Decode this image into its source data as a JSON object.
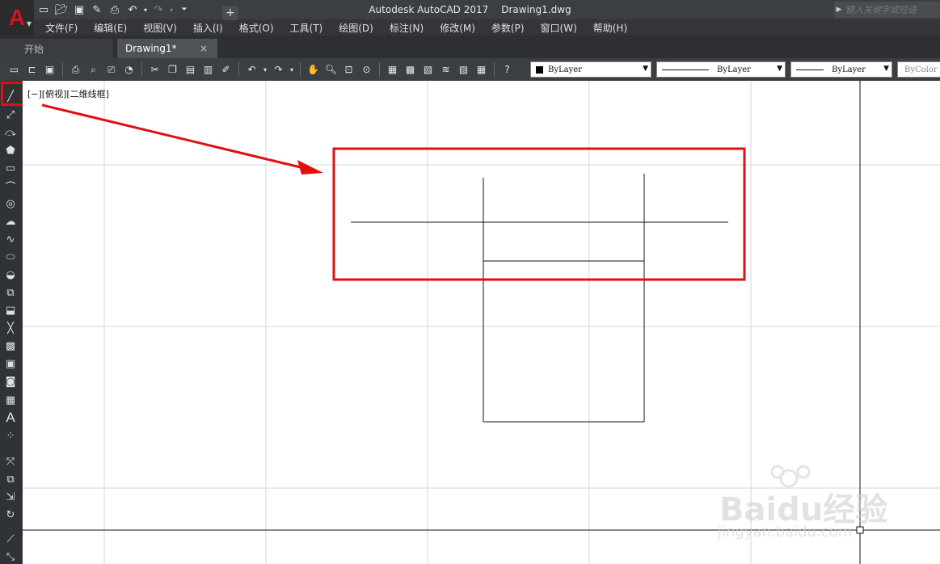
{
  "window": {
    "app_name": "Autodesk AutoCAD 2017",
    "file_name": "Drawing1.dwg",
    "search_placeholder": "键入关键字或短语"
  },
  "menus": [
    "文件(F)",
    "编辑(E)",
    "视图(V)",
    "插入(I)",
    "格式(O)",
    "工具(T)",
    "绘图(D)",
    "标注(N)",
    "修改(M)",
    "参数(P)",
    "窗口(W)",
    "帮助(H)"
  ],
  "tabs": {
    "start": "开始",
    "drawing": "Drawing1*",
    "close_glyph": "×",
    "add_glyph": "+"
  },
  "properties": {
    "color": "ByLayer",
    "linetype": "ByLayer",
    "lineweight": "ByLayer",
    "plotstyle": "ByColor"
  },
  "viewport_label": "[−][俯视][二维线框]",
  "watermark": {
    "brand": "Baidu经验",
    "url": "jingyan.baidu.com"
  },
  "colors": {
    "highlight": "#e01010",
    "accent_logo": "#d4151d"
  },
  "icons": {
    "left_palette": [
      "line-icon",
      "polyline-icon",
      "arc-icon",
      "polygon-icon",
      "rectangle-icon",
      "arc-tool-icon",
      "circle-icon",
      "revision-cloud-icon",
      "spline-icon",
      "ellipse-icon",
      "ellipse-arc-icon",
      "insert-block-icon",
      "make-block-icon",
      "point-icon",
      "hatch-icon",
      "gradient-icon",
      "region-icon",
      "table-icon",
      "multiline-text-icon",
      "add-selected-icon",
      "move-icon",
      "copy-icon",
      "stretch-icon",
      "rotate-icon",
      "mirror-icon",
      "scale-icon"
    ]
  }
}
